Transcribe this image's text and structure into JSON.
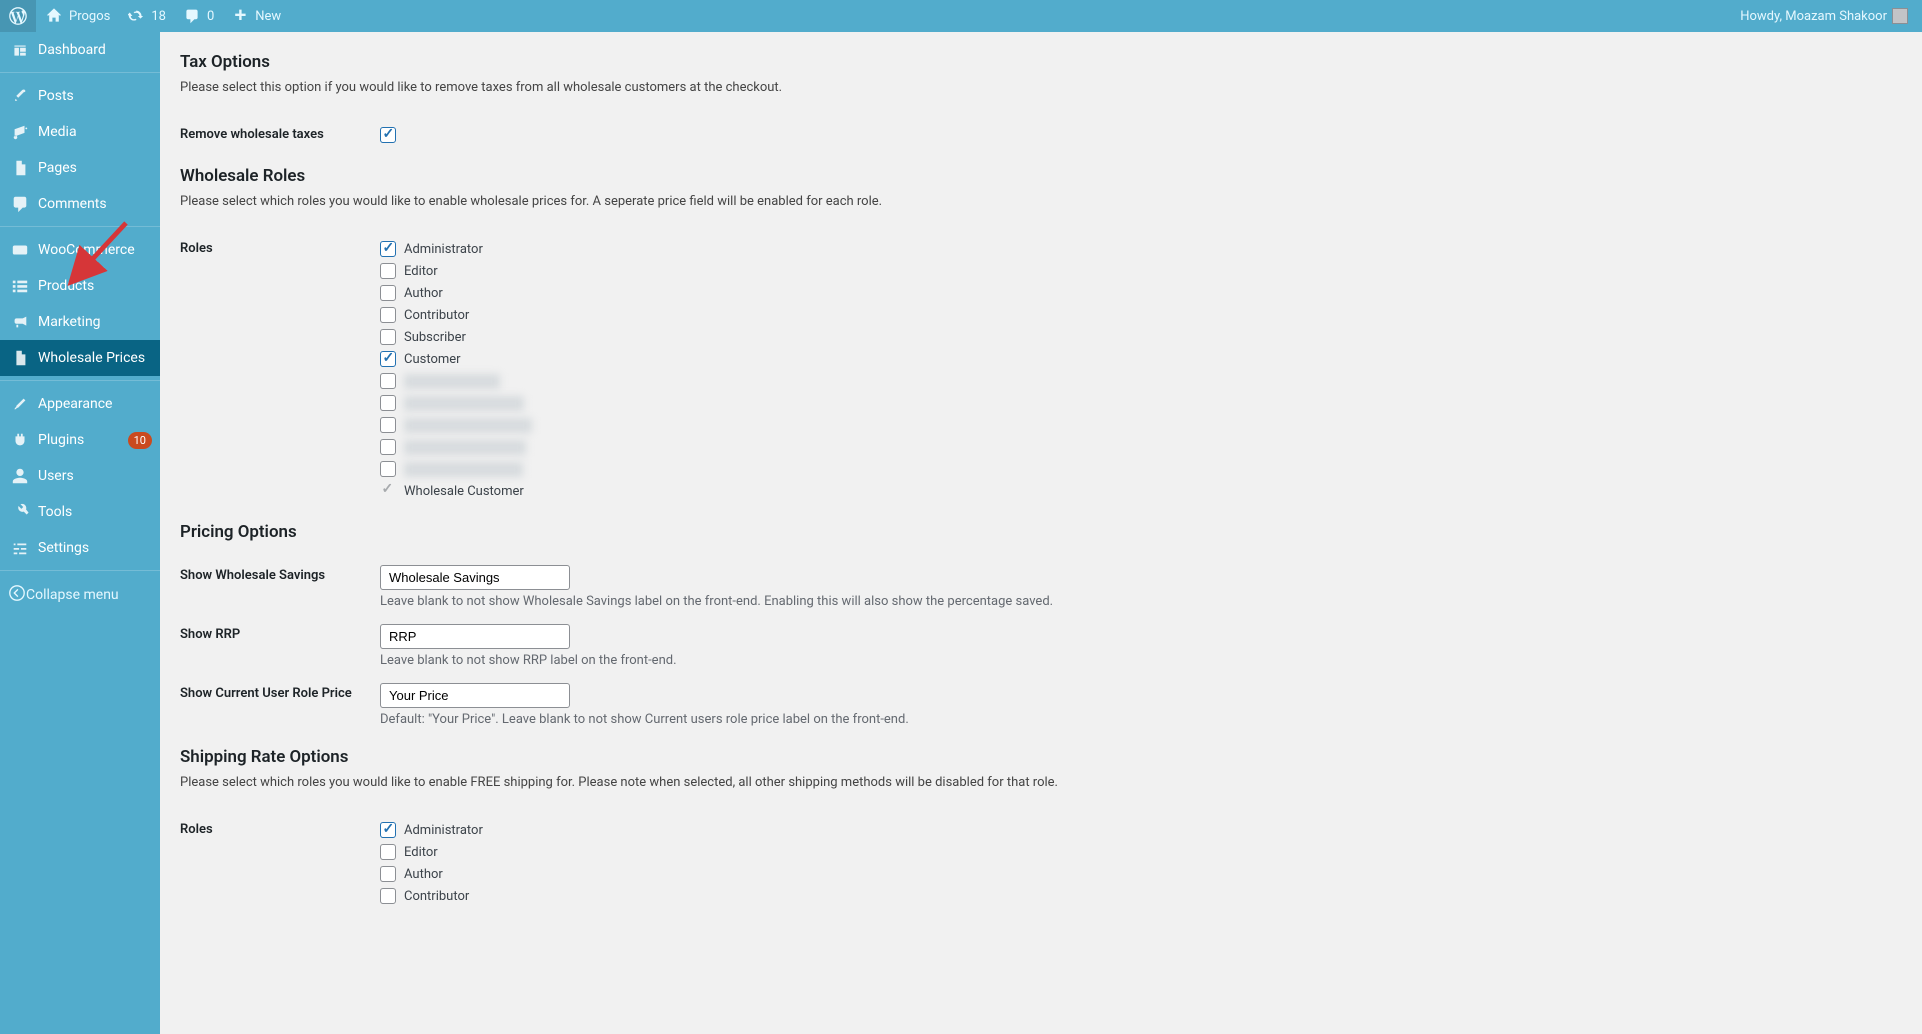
{
  "adminbar": {
    "site_name": "Progos",
    "updates_count": "18",
    "comments_count": "0",
    "new_label": "New",
    "howdy": "Howdy, Moazam Shakoor"
  },
  "sidebar": {
    "items": [
      {
        "label": "Dashboard"
      },
      {
        "label": "Posts"
      },
      {
        "label": "Media"
      },
      {
        "label": "Pages"
      },
      {
        "label": "Comments"
      },
      {
        "label": "WooCommerce"
      },
      {
        "label": "Products"
      },
      {
        "label": "Marketing"
      },
      {
        "label": "Wholesale Prices"
      },
      {
        "label": "Appearance"
      },
      {
        "label": "Plugins",
        "badge": "10"
      },
      {
        "label": "Users"
      },
      {
        "label": "Tools"
      },
      {
        "label": "Settings"
      }
    ],
    "collapse": "Collapse menu"
  },
  "sections": {
    "tax": {
      "title": "Tax Options",
      "desc": "Please select this option if you would like to remove taxes from all wholesale customers at the checkout.",
      "remove_label": "Remove wholesale taxes"
    },
    "roles": {
      "title": "Wholesale Roles",
      "desc": "Please select which roles you would like to enable wholesale prices for. A seperate price field will be enabled for each role.",
      "label": "Roles",
      "items": [
        {
          "text": "Administrator",
          "checked": true
        },
        {
          "text": "Editor",
          "checked": false
        },
        {
          "text": "Author",
          "checked": false
        },
        {
          "text": "Contributor",
          "checked": false
        },
        {
          "text": "Subscriber",
          "checked": false
        },
        {
          "text": "Customer",
          "checked": true
        },
        {
          "text": "Redacted role",
          "checked": false,
          "blur": true
        },
        {
          "text": "Redacted role two",
          "checked": false,
          "blur": true
        },
        {
          "text": "Redacted role three",
          "checked": false,
          "blur": true
        },
        {
          "text": "Redacted role four",
          "checked": false,
          "blur": true
        },
        {
          "text": "Redacted role five",
          "checked": false,
          "blur": true
        },
        {
          "text": "Wholesale Customer",
          "locked": true
        }
      ]
    },
    "pricing": {
      "title": "Pricing Options",
      "savings_label": "Show Wholesale Savings",
      "savings_value": "Wholesale Savings",
      "savings_help": "Leave blank to not show Wholesale Savings label on the front-end. Enabling this will also show the percentage saved.",
      "rrp_label": "Show RRP",
      "rrp_value": "RRP",
      "rrp_help": "Leave blank to not show RRP label on the front-end.",
      "role_price_label": "Show Current User Role Price",
      "role_price_value": "Your Price",
      "role_price_help": "Default: \"Your Price\". Leave blank to not show Current users role price label on the front-end."
    },
    "shipping": {
      "title": "Shipping Rate Options",
      "desc": "Please select which roles you would like to enable FREE shipping for. Please note when selected, all other shipping methods will be disabled for that role.",
      "label": "Roles",
      "items": [
        {
          "text": "Administrator",
          "checked": true
        },
        {
          "text": "Editor",
          "checked": false
        },
        {
          "text": "Author",
          "checked": false
        },
        {
          "text": "Contributor",
          "checked": false
        }
      ]
    }
  }
}
